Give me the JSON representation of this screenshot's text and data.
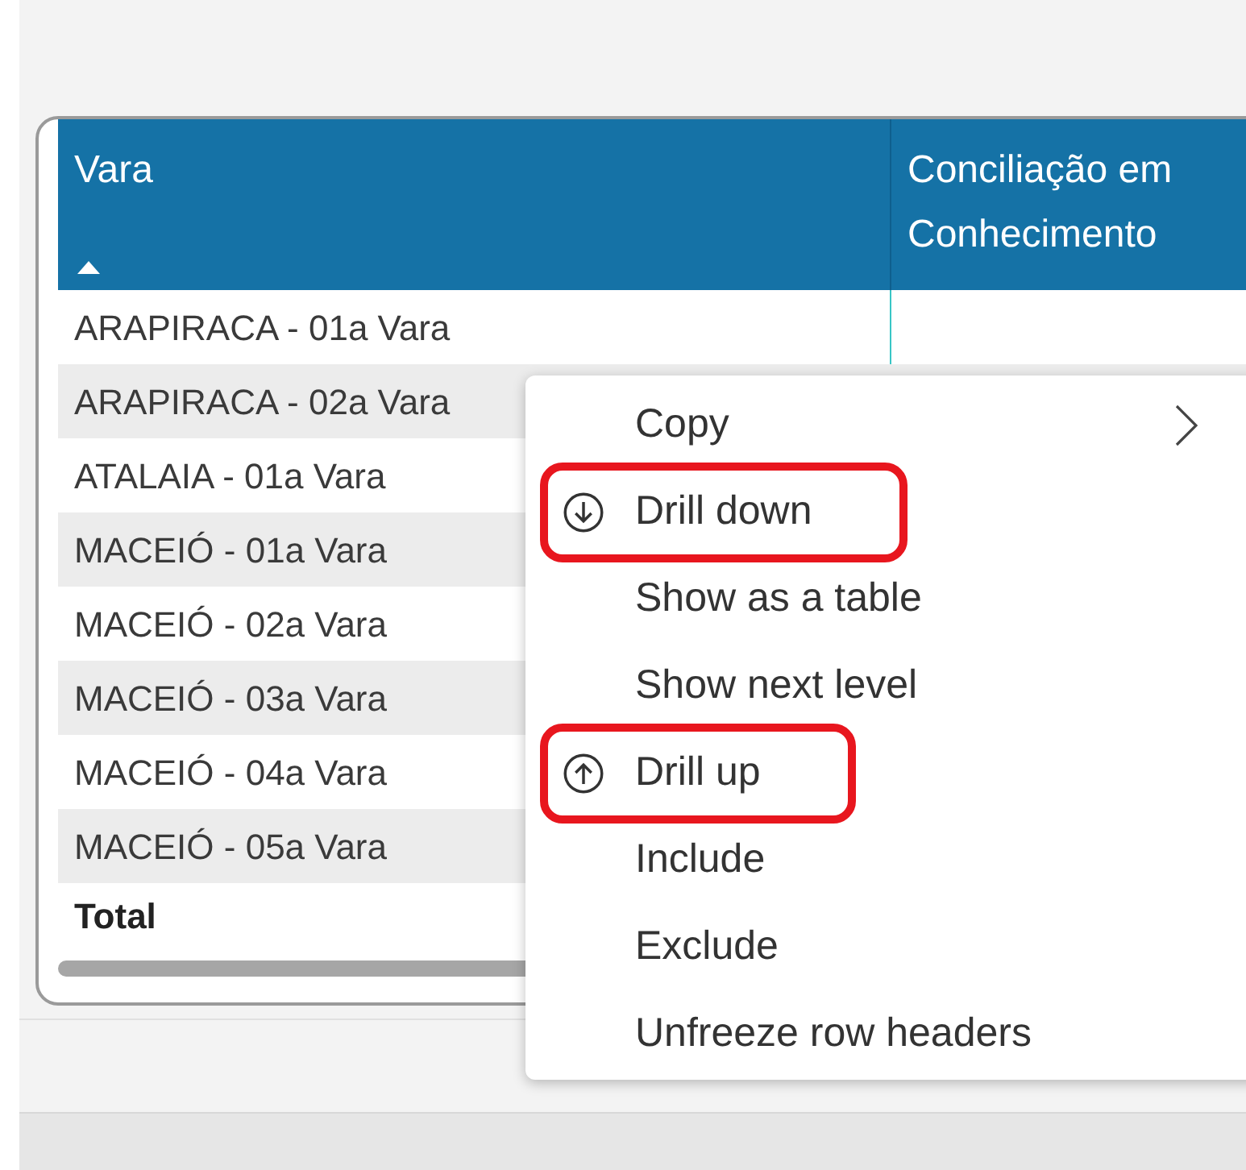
{
  "table": {
    "columns": [
      {
        "label": "Vara",
        "sorted_ascending": true
      },
      {
        "label": "Conciliação em Conhecimento"
      }
    ],
    "rows": [
      {
        "label": "ARAPIRACA - 01a Vara"
      },
      {
        "label": "ARAPIRACA - 02a Vara"
      },
      {
        "label": "ATALAIA - 01a Vara"
      },
      {
        "label": "MACEIÓ - 01a Vara"
      },
      {
        "label": "MACEIÓ - 02a Vara"
      },
      {
        "label": "MACEIÓ - 03a Vara"
      },
      {
        "label": "MACEIÓ - 04a Vara"
      },
      {
        "label": "MACEIÓ - 05a Vara"
      }
    ],
    "total": "Total"
  },
  "context_menu": {
    "items": [
      {
        "label": "Copy",
        "kind": "submenu",
        "highlighted": false
      },
      {
        "label": "Drill down",
        "kind": "drill-down",
        "highlighted": true
      },
      {
        "label": "Show as a table",
        "kind": "plain",
        "highlighted": false
      },
      {
        "label": "Show next level",
        "kind": "plain",
        "highlighted": false
      },
      {
        "label": "Drill up",
        "kind": "drill-up",
        "highlighted": true
      },
      {
        "label": "Include",
        "kind": "plain",
        "highlighted": false
      },
      {
        "label": "Exclude",
        "kind": "plain",
        "highlighted": false
      },
      {
        "label": "Unfreeze row headers",
        "kind": "plain",
        "highlighted": false
      }
    ]
  }
}
